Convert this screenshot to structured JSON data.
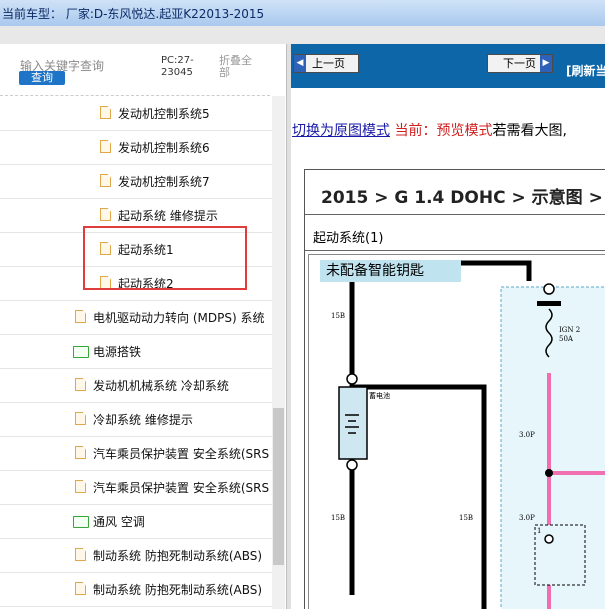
{
  "title": "当前车型：  厂家:D-东风悦达.起亚K22013-2015",
  "search": {
    "keyword_label": "输入关键字查询",
    "query_button": "查询",
    "pc_code": "PC:27-23045",
    "fold_all": "折叠全部"
  },
  "tree": {
    "items": [
      {
        "label": "发动机控制系统5",
        "type": "doc",
        "level": 2
      },
      {
        "label": "发动机控制系统6",
        "type": "doc",
        "level": 2
      },
      {
        "label": "发动机控制系统7",
        "type": "doc",
        "level": 2
      },
      {
        "label": "起动系统 维修提示",
        "type": "doc",
        "level": 2
      },
      {
        "label": "起动系统1",
        "type": "doc",
        "level": 2
      },
      {
        "label": "起动系统2",
        "type": "doc",
        "level": 2
      },
      {
        "label": "电机驱动动力转向 (MDPS) 系统",
        "type": "doc",
        "level": 1
      },
      {
        "label": "电源搭铁",
        "type": "folder",
        "level": 1
      },
      {
        "label": "发动机机械系统 冷却系统",
        "type": "doc",
        "level": 1
      },
      {
        "label": "冷却系统 维修提示",
        "type": "doc",
        "level": 1
      },
      {
        "label": "汽车乘员保护装置 安全系统(SRS",
        "type": "doc",
        "level": 1
      },
      {
        "label": "汽车乘员保护装置 安全系统(SRS",
        "type": "doc",
        "level": 1
      },
      {
        "label": "通风 空调",
        "type": "folder",
        "level": 1
      },
      {
        "label": "制动系统 防抱死制动系统(ABS)",
        "type": "doc",
        "level": 1
      },
      {
        "label": "制动系统 防抱死制动系统(ABS)",
        "type": "doc",
        "level": 1
      }
    ]
  },
  "viewer": {
    "prev_button": "上一页",
    "next_button": "下一页",
    "refresh": "[刷新当",
    "mode_switch_link": "切换为原图模式",
    "current_label": "当前：",
    "current_mode": "预览模式",
    "hint": "若需看大图,",
    "breadcrumb": "2015 > G 1.4 DOHC > 示意图 >",
    "section_title": "起动系统(1)",
    "key_label": "未配备智能钥匙",
    "diagram": {
      "wire_15b_a": "15B",
      "wire_15b_b": "15B",
      "wire_15b_c": "15B",
      "battery": "蓄电池",
      "fuse_name": "IGN 2",
      "fuse_rating": "50A",
      "wire_30p_a": "3.0P",
      "wire_30p_b": "3.0P",
      "pin_1": "1"
    }
  },
  "colors": {
    "nav_blue": "#0c66a8",
    "highlight_red": "#e03c3c",
    "link_blue": "#1a1aa6",
    "mode_red": "#d21f1f",
    "key_box": "#bfe3ef",
    "wire_pink": "#ef6fb1"
  },
  "icons": [
    "document-icon",
    "folder-icon",
    "arrow-left-icon",
    "arrow-right-icon"
  ]
}
